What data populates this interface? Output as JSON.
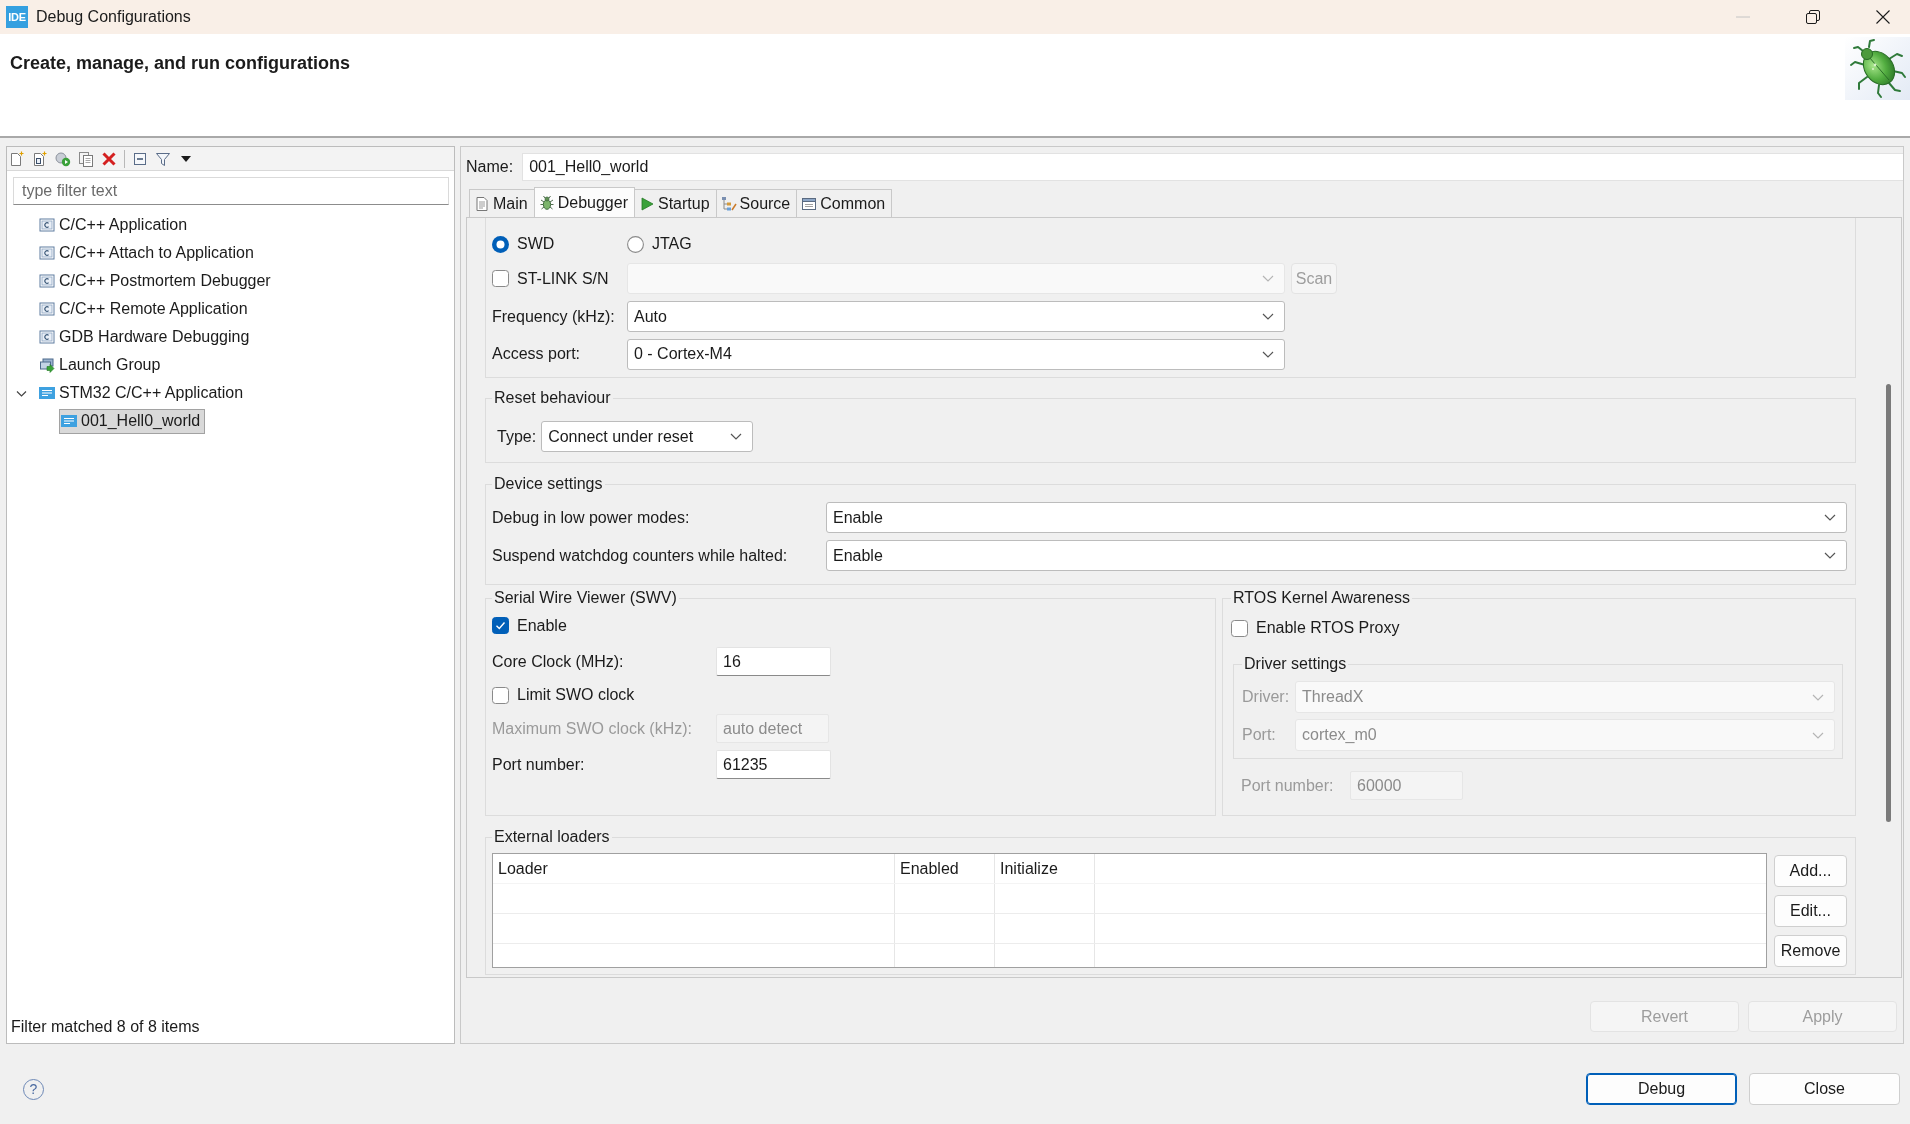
{
  "window": {
    "icon": "IDE",
    "title": "Debug Configurations",
    "minimize_disabled": true
  },
  "header": {
    "title": "Create, manage, and run configurations"
  },
  "sidebar": {
    "filter": {
      "placeholder": "type filter text"
    },
    "items": [
      {
        "label": "C/C++ Application",
        "kind": "c",
        "selected": false
      },
      {
        "label": "C/C++ Attach to Application",
        "kind": "c",
        "selected": false
      },
      {
        "label": "C/C++ Postmortem Debugger",
        "kind": "c",
        "selected": false
      },
      {
        "label": "C/C++ Remote Application",
        "kind": "c",
        "selected": false
      },
      {
        "label": "GDB Hardware Debugging",
        "kind": "c",
        "selected": false
      },
      {
        "label": "Launch Group",
        "kind": "group",
        "selected": false
      },
      {
        "label": "STM32 C/C++ Application",
        "kind": "stm32",
        "selected": false,
        "expanded": true,
        "children": [
          {
            "label": "001_Hell0_world",
            "kind": "stm32",
            "selected": true
          }
        ]
      }
    ],
    "status": "Filter matched 8 of 8 items"
  },
  "editor": {
    "name_label": "Name:",
    "name": "001_Hell0_world",
    "tabs": [
      {
        "label": "Main",
        "kind": "main",
        "selected": false
      },
      {
        "label": "Debugger",
        "kind": "debugger",
        "selected": true
      },
      {
        "label": "Startup",
        "kind": "startup",
        "selected": false
      },
      {
        "label": "Source",
        "kind": "source",
        "selected": false
      },
      {
        "label": "Common",
        "kind": "common",
        "selected": false
      }
    ],
    "interface": {
      "options": [
        {
          "label": "SWD",
          "selected": true
        },
        {
          "label": "JTAG",
          "selected": false
        }
      ],
      "stlink": {
        "label": "ST-LINK S/N",
        "checked": false
      },
      "serial": {
        "disabled": true
      },
      "scan": {
        "label": "Scan",
        "disabled": true
      },
      "fields": [
        {
          "label": "Frequency (kHz):",
          "value": "Auto"
        },
        {
          "label": "Access port:",
          "value": "0 - Cortex-M4"
        }
      ]
    },
    "reset": {
      "title": "Reset behaviour",
      "type_label": "Type:",
      "type": "Connect under reset"
    },
    "device": {
      "title": "Device settings",
      "fields": [
        {
          "label": "Debug in low power modes:",
          "value": "Enable"
        },
        {
          "label": "Suspend watchdog counters while halted:",
          "value": "Enable"
        }
      ]
    },
    "swv": {
      "title": "Serial Wire Viewer (SWV)",
      "enable": {
        "label": "Enable",
        "checked": true
      },
      "core_clock": {
        "label": "Core Clock (MHz):",
        "value": "16"
      },
      "limit": {
        "label": "Limit SWO clock",
        "checked": false
      },
      "max_clock": {
        "label": "Maximum SWO clock (kHz):",
        "value": "auto detect",
        "disabled": true
      },
      "port": {
        "label": "Port number:",
        "value": "61235"
      }
    },
    "rtos": {
      "title": "RTOS Kernel Awareness",
      "enable": {
        "label": "Enable RTOS Proxy",
        "checked": false
      },
      "driver_settings": {
        "title": "Driver settings",
        "fields": [
          {
            "label": "Driver:",
            "value": "ThreadX",
            "disabled": true
          },
          {
            "label": "Port:",
            "value": "cortex_m0",
            "disabled": true
          }
        ]
      },
      "port": {
        "label": "Port number:",
        "value": "60000",
        "disabled": true
      }
    },
    "loaders": {
      "title": "External loaders",
      "columns": [
        "Loader",
        "Enabled",
        "Initialize"
      ],
      "buttons": [
        "Add...",
        "Edit...",
        "Remove"
      ]
    },
    "actions": [
      {
        "label": "Revert",
        "disabled": true
      },
      {
        "label": "Apply",
        "disabled": true
      }
    ]
  },
  "footer": {
    "help": "?",
    "buttons": [
      {
        "label": "Debug",
        "default": true
      },
      {
        "label": "Close",
        "default": false
      }
    ]
  }
}
